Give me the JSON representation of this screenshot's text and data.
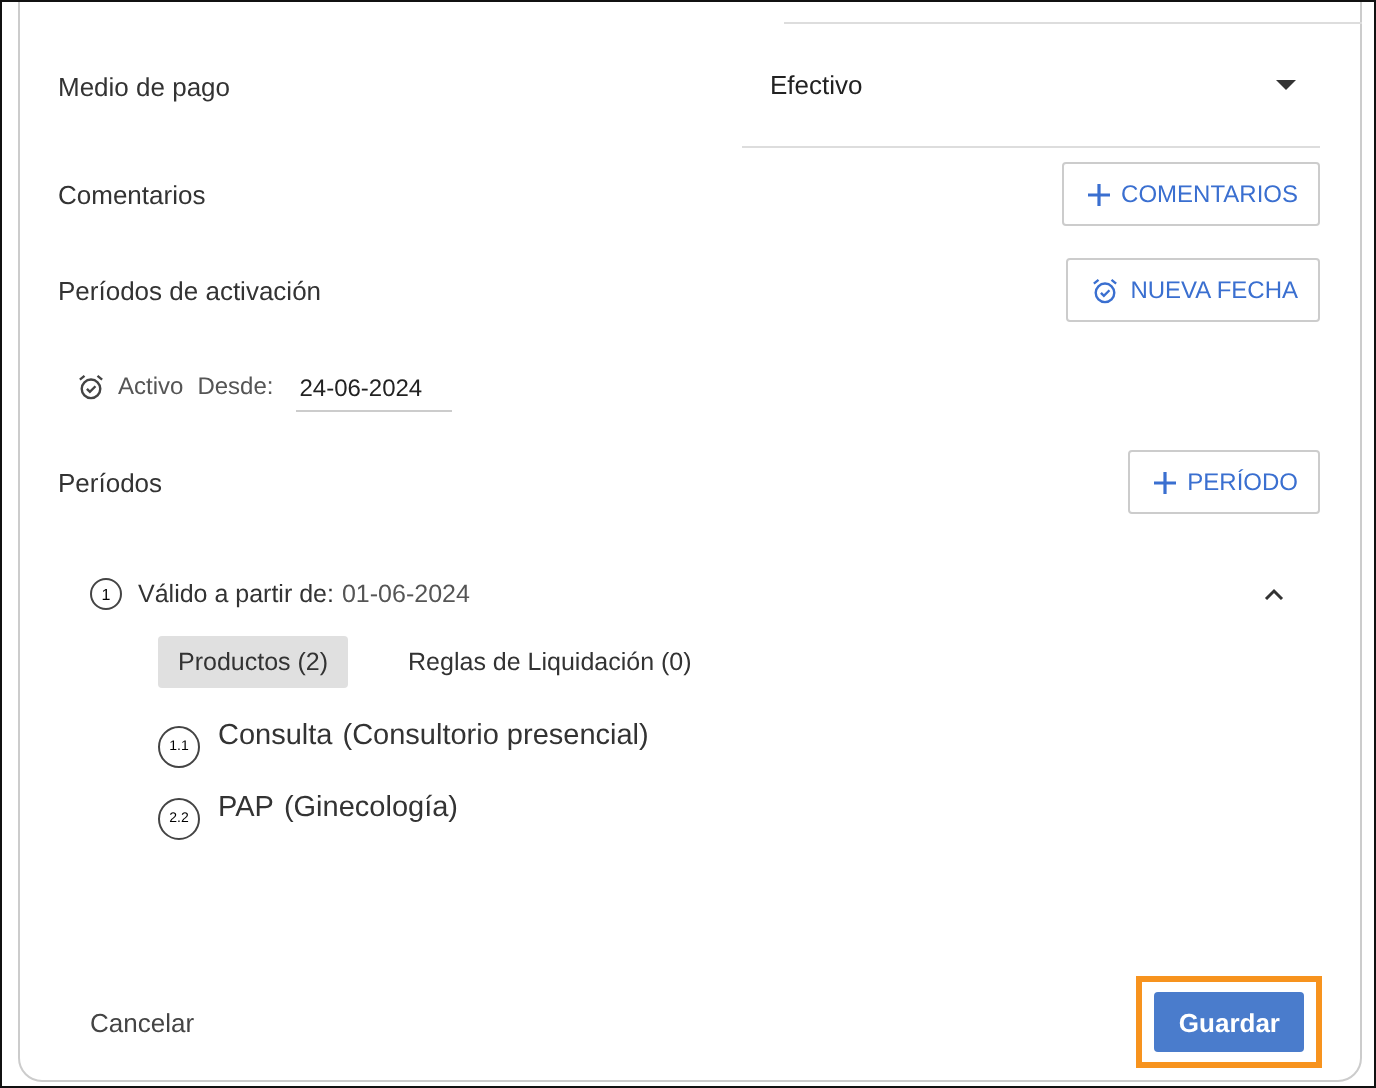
{
  "payment": {
    "label": "Medio de pago",
    "value": "Efectivo"
  },
  "comments": {
    "label": "Comentarios",
    "button": "COMENTARIOS"
  },
  "activation": {
    "label": "Períodos de activación",
    "button": "NUEVA FECHA",
    "status": "Activo",
    "since_label": "Desde:",
    "since_value": "24-06-2024"
  },
  "periods": {
    "label": "Períodos",
    "button": "PERÍODO",
    "items": [
      {
        "number": "1",
        "title": "Válido a partir de:",
        "date": "01-06-2024",
        "expanded": true,
        "tabs": [
          {
            "label": "Productos (2)",
            "selected": true
          },
          {
            "label": "Reglas de Liquidación (0)",
            "selected": false
          }
        ],
        "products": [
          {
            "number": "1.1",
            "name": "Consulta",
            "detail": "(Consultorio presencial)"
          },
          {
            "number": "2.2",
            "name": "PAP",
            "detail": "(Ginecología)"
          }
        ]
      }
    ]
  },
  "footer": {
    "cancel": "Cancelar",
    "save": "Guardar",
    "save_highlighted": true
  }
}
